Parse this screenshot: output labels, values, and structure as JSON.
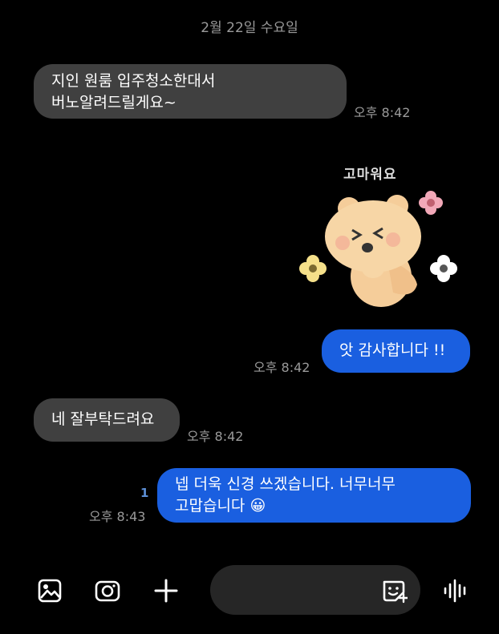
{
  "date_header": "2월 22일 수요일",
  "messages": [
    {
      "direction": "received",
      "lines": [
        "지인 원룸 입주청소한대서",
        "버노알려드릴게요~"
      ],
      "time": "오후 8:42"
    },
    {
      "direction": "received",
      "type": "sticker",
      "caption": "고마워요",
      "time": ""
    },
    {
      "direction": "sent",
      "lines": [
        "앗 감사합니다 !!"
      ],
      "time": "오후 8:42"
    },
    {
      "direction": "received",
      "lines": [
        "네 잘부탁드려요"
      ],
      "time": "오후 8:42"
    },
    {
      "direction": "sent",
      "lines": [
        "넵 더욱 신경 쓰겠습니다. 너무너무",
        "고맙습니다 😀"
      ],
      "time": "오후 8:43",
      "unread_count": "1"
    }
  ],
  "composer": {
    "icons": [
      "gallery-icon",
      "camera-icon",
      "plus-icon",
      "sticker-icon",
      "voice-icon"
    ]
  },
  "colors": {
    "background": "#000000",
    "received_bubble": "#404040",
    "sent_bubble": "#1a5fe0",
    "timestamp": "#9a9a9a",
    "unread": "#5c8fd6",
    "composer_field": "#262626"
  }
}
